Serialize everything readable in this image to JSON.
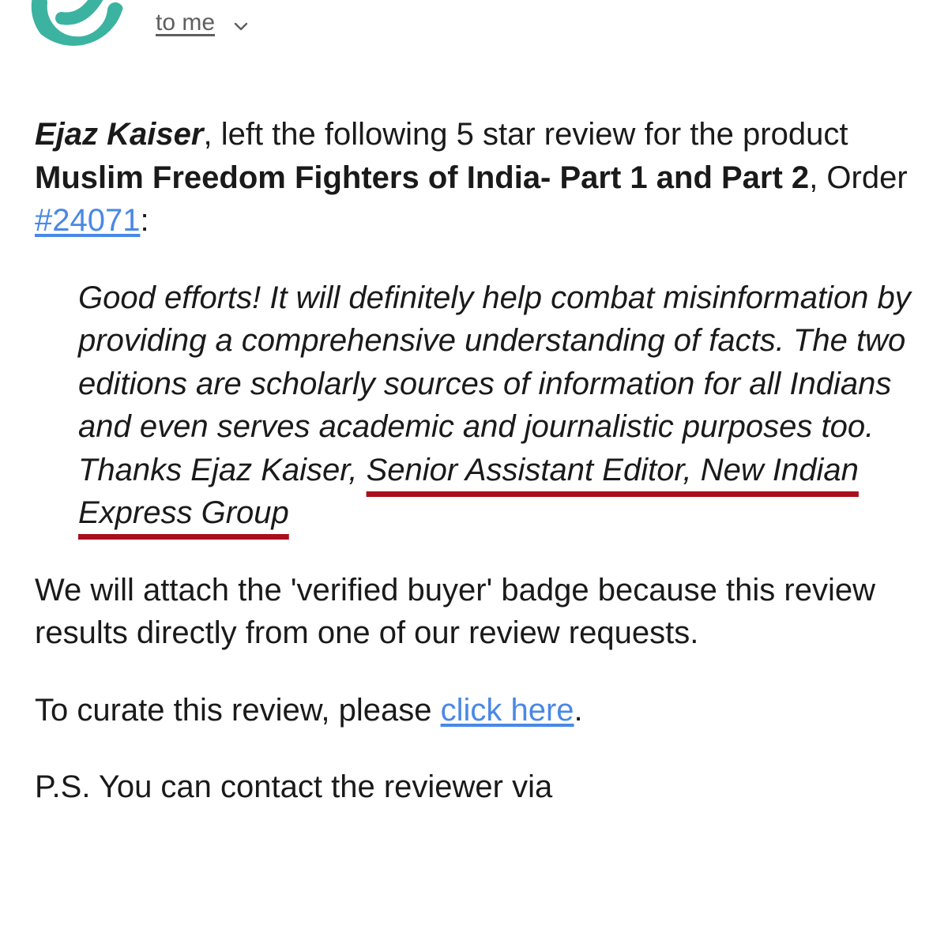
{
  "header": {
    "recipient_label": "to me",
    "avatar_icon": "store-logo-icon",
    "accent_color": "#3bb3a0"
  },
  "message": {
    "reviewer_name": "Ejaz Kaiser",
    "intro_text_1": ", left the following 5 star review for the product ",
    "product_name": "Muslim Freedom Fighters of India- Part 1 and Part 2",
    "intro_text_2": ", Order ",
    "order_link": "#24071",
    "intro_text_3": ":",
    "review_text": "Good efforts! It will definitely help combat misinformation by providing a comprehensive understanding of facts. The two editions are scholarly sources of information for all Indians and even serves academic and journalistic purposes too. Thanks Ejaz Kaiser, ",
    "review_highlight": "Senior Assistant Editor, New Indian Express Group",
    "verified_text": "We will attach the 'verified buyer' badge because this review results directly from one of our review requests.",
    "curate_text": "To curate this review, please ",
    "curate_link": "click here",
    "curate_end": ".",
    "ps_text": "P.S. You can contact the reviewer via"
  },
  "colors": {
    "link": "#4a88e6",
    "highlight_underline": "#a90f1c"
  }
}
